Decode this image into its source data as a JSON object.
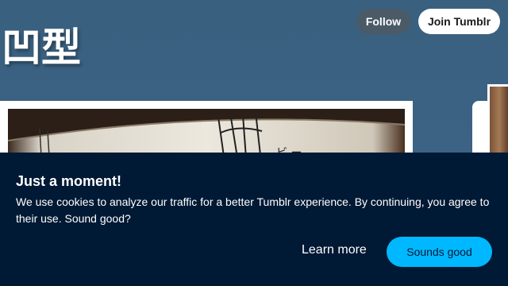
{
  "blog": {
    "title": "凹型"
  },
  "header": {
    "follow_label": "Follow",
    "join_label": "Join Tumblr"
  },
  "cookie_banner": {
    "title": "Just a moment!",
    "message": "We use cookies to analyze our traffic for a better Tumblr experience. By continuing, you agree to their use. Sound good?",
    "learn_more_label": "Learn more",
    "accept_label": "Sounds good"
  },
  "colors": {
    "page_background": "#3d6386",
    "banner_background": "#001935",
    "accept_button": "#00b8ff",
    "follow_button": "#4b5a67"
  }
}
